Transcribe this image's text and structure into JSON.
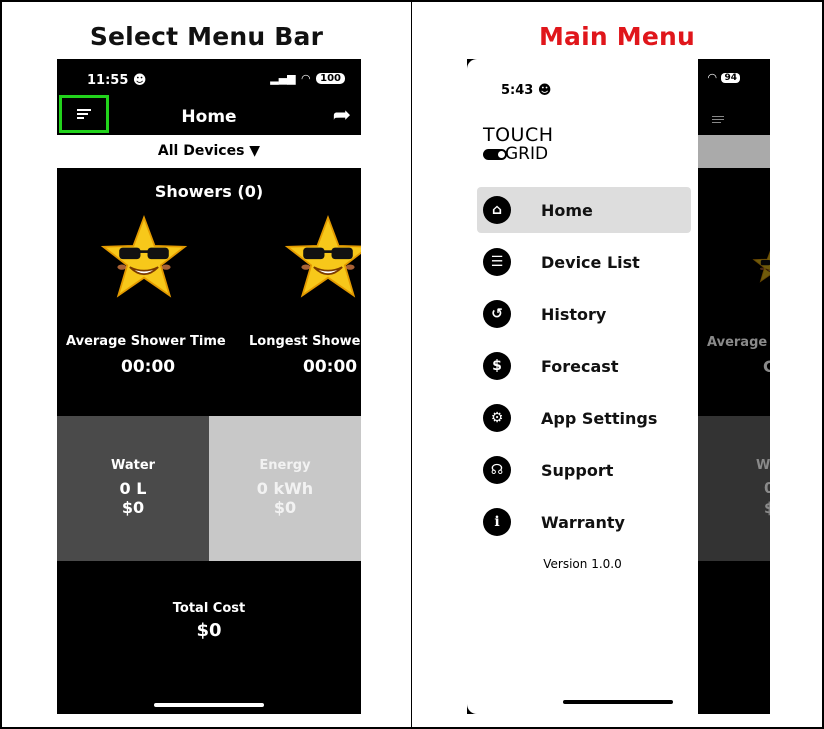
{
  "left": {
    "title": "Select Menu Bar",
    "status_time": "11:55",
    "battery": "100",
    "header_title": "Home",
    "devices_label": "All Devices",
    "showers_label": "Showers (0)",
    "metrics": [
      {
        "label": "Average Shower Time",
        "value": "00:00"
      },
      {
        "label": "Longest Showe",
        "value": "00:00"
      }
    ],
    "water": {
      "title": "Water",
      "amount": "0 L",
      "cost": "$0",
      "color": "#4a4a4a"
    },
    "energy": {
      "title": "Energy",
      "amount": "0 kWh",
      "cost": "$0",
      "color": "#c8c8c8"
    },
    "total": {
      "title": "Total Cost",
      "value": "$0"
    },
    "highlight_color": "#22d31c"
  },
  "right": {
    "title": "Main Menu",
    "title_color": "#e0161b",
    "status_time": "5:43",
    "battery": "94",
    "logo_top": "TOUCH",
    "logo_bottom": "GRID",
    "menu": [
      {
        "label": "Home",
        "icon": "home-icon",
        "active": true
      },
      {
        "label": "Device List",
        "icon": "list-icon"
      },
      {
        "label": "History",
        "icon": "history-icon"
      },
      {
        "label": "Forecast",
        "icon": "dollar-icon"
      },
      {
        "label": "App Settings",
        "icon": "gear-icon"
      },
      {
        "label": "Support",
        "icon": "headset-icon"
      },
      {
        "label": "Warranty",
        "icon": "info-icon"
      }
    ],
    "version": "Version 1.0.0",
    "bg_average": "Average",
    "bg_value": "C",
    "bg_water": "Wa",
    "bg_amount": "0",
    "bg_cost": "$"
  }
}
